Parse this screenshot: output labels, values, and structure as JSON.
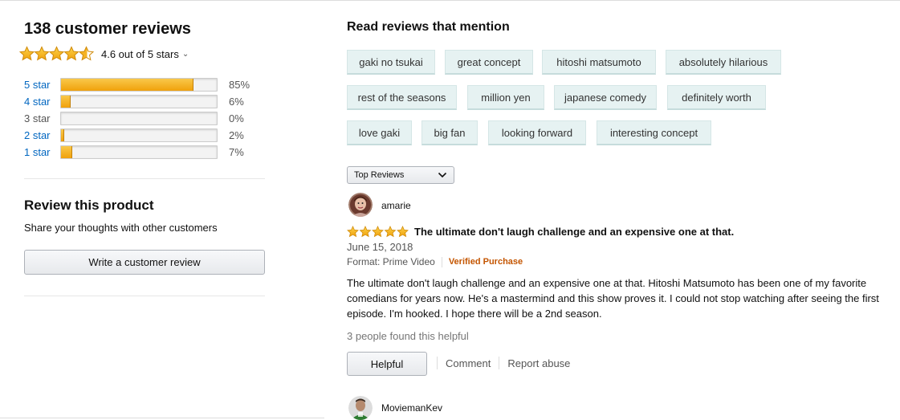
{
  "summary": {
    "total_reviews": "138 customer reviews",
    "average_text": "4.6 out of 5 stars",
    "average_value": 4.6,
    "star_color": "#f0a10c"
  },
  "histogram": [
    {
      "label": "5 star",
      "percent_text": "85%",
      "value": 0.85,
      "link": true
    },
    {
      "label": "4 star",
      "percent_text": "6%",
      "value": 0.06,
      "link": true
    },
    {
      "label": "3 star",
      "percent_text": "0%",
      "value": 0.0,
      "link": false
    },
    {
      "label": "2 star",
      "percent_text": "2%",
      "value": 0.02,
      "link": true
    },
    {
      "label": "1 star",
      "percent_text": "7%",
      "value": 0.07,
      "link": true
    }
  ],
  "review_product": {
    "title": "Review this product",
    "subtitle": "Share your thoughts with other customers",
    "button_label": "Write a customer review"
  },
  "mentions": {
    "title": "Read reviews that mention",
    "chips": [
      "gaki no tsukai",
      "great concept",
      "hitoshi matsumoto",
      "absolutely hilarious",
      "rest of the seasons",
      "million yen",
      "japanese comedy",
      "definitely worth",
      "love gaki",
      "big fan",
      "looking forward",
      "interesting concept"
    ]
  },
  "sort": {
    "selected": "Top Reviews"
  },
  "reviews": [
    {
      "author": "amarie",
      "rating": 5,
      "title": "The ultimate don't laugh challenge and an expensive one at that.",
      "date": "June 15, 2018",
      "format": "Format: Prime Video",
      "verified": "Verified Purchase",
      "body": "The ultimate don't laugh challenge and an expensive one at that. Hitoshi Matsumoto has been one of my favorite comedians for years now. He's a mastermind and this show proves it. I could not stop watching after seeing the first episode. I'm hooked. I hope there will be a 2nd season.",
      "helpful_count": "3 people found this helpful",
      "helpful_button": "Helpful",
      "comment_link": "Comment",
      "report_link": "Report abuse"
    },
    {
      "author": "MoviemanKev"
    }
  ]
}
